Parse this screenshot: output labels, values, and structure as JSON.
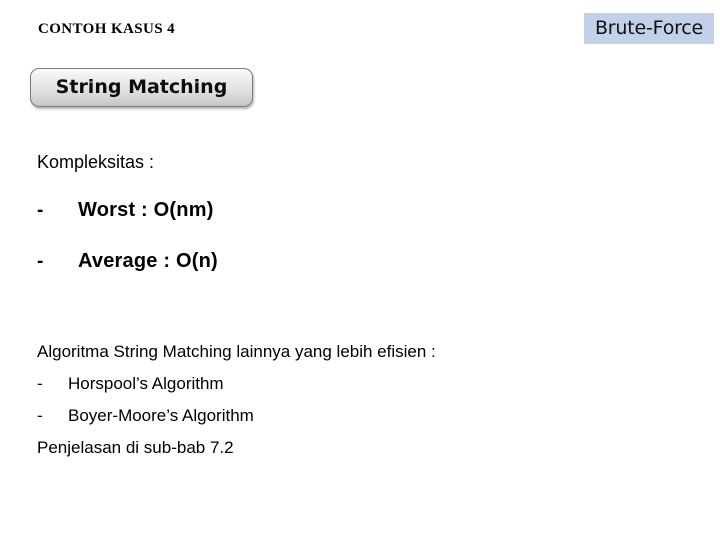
{
  "slide": {
    "background_color": "#ffffff",
    "kicker_title": "CONTOH KASUS 4",
    "corner_label": {
      "text": "Brute-Force",
      "background_color": "#c2d1e8",
      "text_color": "#111111"
    },
    "title_button": {
      "label": "String Matching",
      "border_color": "#7b7b7b",
      "gradient_top_color": "#fbfbfb",
      "gradient_bottom_color": "#c4c4c4"
    },
    "complexity": {
      "heading": "Kompleksitas :",
      "items": [
        {
          "bullet": "-",
          "text": "Worst : O(nm)"
        },
        {
          "bullet": "-",
          "text": "Average : O(n)"
        }
      ]
    },
    "other_algorithms": {
      "intro": "Algoritma String Matching lainnya yang lebih efisien :",
      "items": [
        {
          "bullet": "-",
          "text": "Horspool’s Algorithm"
        },
        {
          "bullet": "-",
          "text": "Boyer-Moore’s Algorithm"
        }
      ],
      "footer": "Penjelasan di sub-bab 7.2"
    }
  }
}
